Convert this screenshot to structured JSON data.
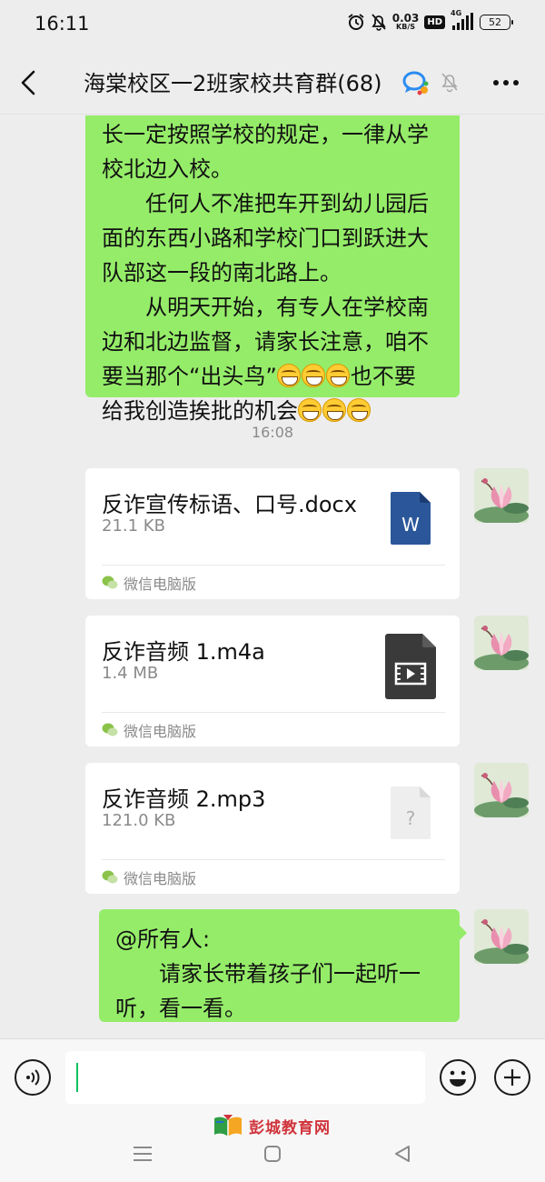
{
  "status_bar": {
    "time": "16:11",
    "net_speed_value": "0.03",
    "net_speed_unit": "KB/S",
    "hd": "HD",
    "signal_label": "4G",
    "battery": "52",
    "icons": [
      "alarm-icon",
      "bell-off-icon",
      "signal-icon",
      "battery-icon"
    ]
  },
  "nav": {
    "title": "海棠校区一2班家校共育群(68)",
    "icons": [
      "back-arrow-icon",
      "enterprise-chat-icon",
      "mute-bell-icon",
      "more-dots-icon"
    ]
  },
  "messages": {
    "msg1": {
      "lines": [
        "长一定按照学校的规定，一律从学",
        "校北边入校。",
        "　　任何人不准把车开到幼儿园后",
        "面的东西小路和学校门口到跃进大",
        "队部这一段的南北路上。",
        "　　从明天开始，有专人在学校南",
        "边和北边监督，请家长注意，咱不"
      ],
      "line8_a": "要当那个“出头鸟”",
      "line8_b": "也不要",
      "line9_a": "给我创造挨批的机会"
    },
    "timestamp": "16:08",
    "files": [
      {
        "name": "反诈宣传标语、口号.docx",
        "size": "21.1 KB",
        "source": "微信电脑版",
        "icon": "word-doc-icon",
        "icon_letter": "W"
      },
      {
        "name": "反诈音频 1.m4a",
        "size": "1.4 MB",
        "source": "微信电脑版",
        "icon": "video-file-icon"
      },
      {
        "name": "反诈音频 2.mp3",
        "size": "121.0 KB",
        "source": "微信电脑版",
        "icon": "unknown-file-icon",
        "icon_letter": "?"
      }
    ],
    "msg5": {
      "line1": "@所有人:",
      "line2": "　　请家长带着孩子们一起听一",
      "line3": "听，看一看。"
    }
  },
  "input_bar": {
    "value": "",
    "icons": [
      "voice-icon",
      "emoji-icon",
      "plus-icon"
    ]
  },
  "watermark": {
    "text": "彭城教育网"
  },
  "colors": {
    "bubble_green": "#95ec69",
    "background": "#ededed",
    "word_blue": "#2b579a",
    "caret_green": "#07c160"
  }
}
